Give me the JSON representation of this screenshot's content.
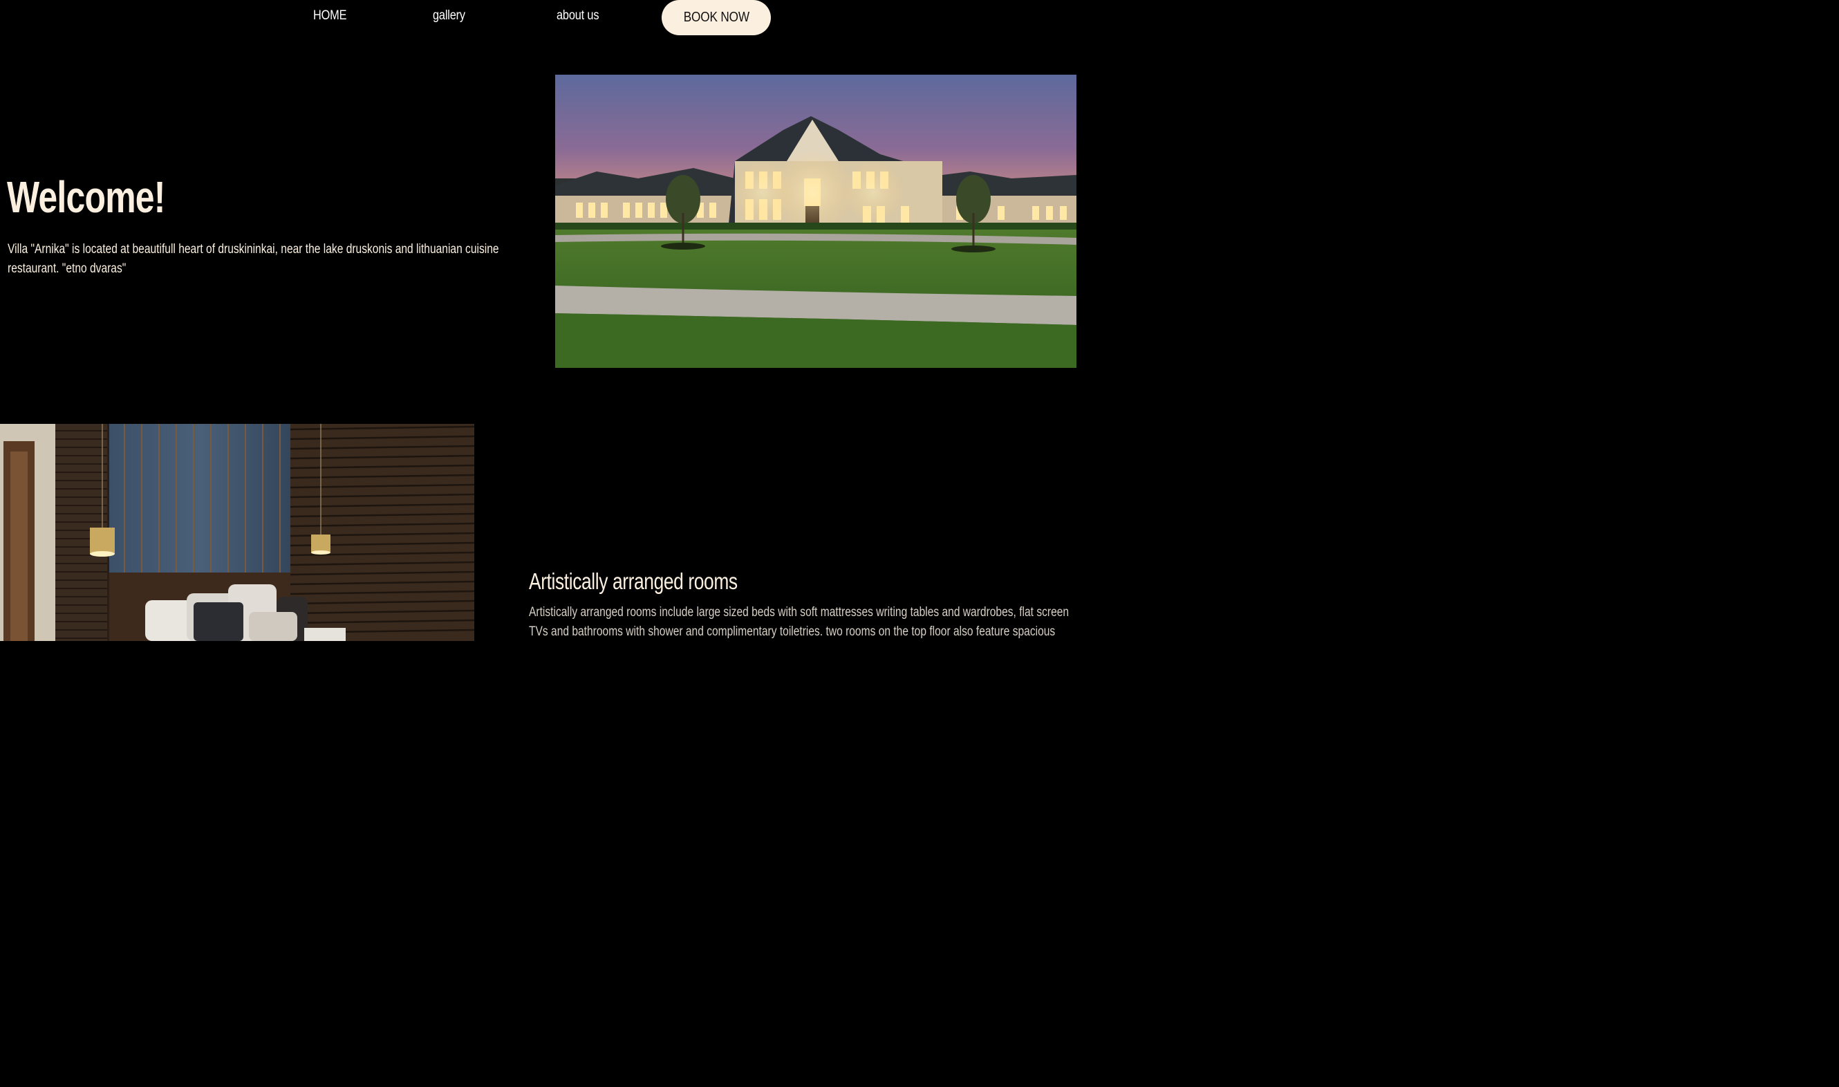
{
  "nav": {
    "home": "HOME",
    "gallery": "gallery",
    "about": "about us",
    "book": "BOOK NOW"
  },
  "hero": {
    "title": "Welcome!",
    "description": "Villa \"Arnika\" is located at beautifull heart of druskininkai, near the lake druskonis and lithuanian cuisine restaurant. \"etno dvaras\""
  },
  "rooms": {
    "title": "Artistically arranged rooms",
    "description": "Artistically arranged rooms include large sized beds with soft mattresses writing tables and wardrobes, flat screen TVs and bathrooms with shower and complimentary toiletries. two rooms on the top floor also feature spacious"
  },
  "colors": {
    "background": "#000000",
    "accent": "#fbf0df",
    "text_muted": "#d6cfc4"
  }
}
